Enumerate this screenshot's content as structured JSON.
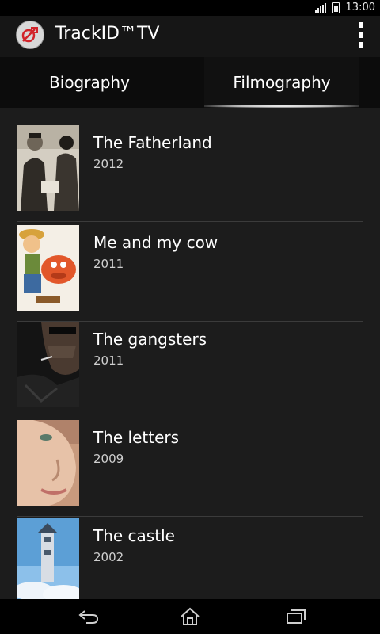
{
  "status": {
    "time": "13:00"
  },
  "app": {
    "title": "TrackID™TV"
  },
  "tabs": [
    {
      "label": "Biography",
      "selected": false
    },
    {
      "label": "Filmography",
      "selected": true
    }
  ],
  "films": [
    {
      "title": "The Fatherland",
      "year": "2012"
    },
    {
      "title": "Me and my cow",
      "year": "2011"
    },
    {
      "title": "The gangsters",
      "year": "2011"
    },
    {
      "title": "The letters",
      "year": "2009"
    },
    {
      "title": "The castle",
      "year": "2002"
    }
  ],
  "colors": {
    "background": "#1c1c1c",
    "actionbar": "#161616",
    "tabbar": "#0c0c0c",
    "accent": "#ffffff"
  },
  "icons": [
    "trackid-logo-icon",
    "overflow-menu-icon",
    "back-icon",
    "home-icon",
    "recent-apps-icon",
    "signal-icon",
    "battery-icon"
  ]
}
